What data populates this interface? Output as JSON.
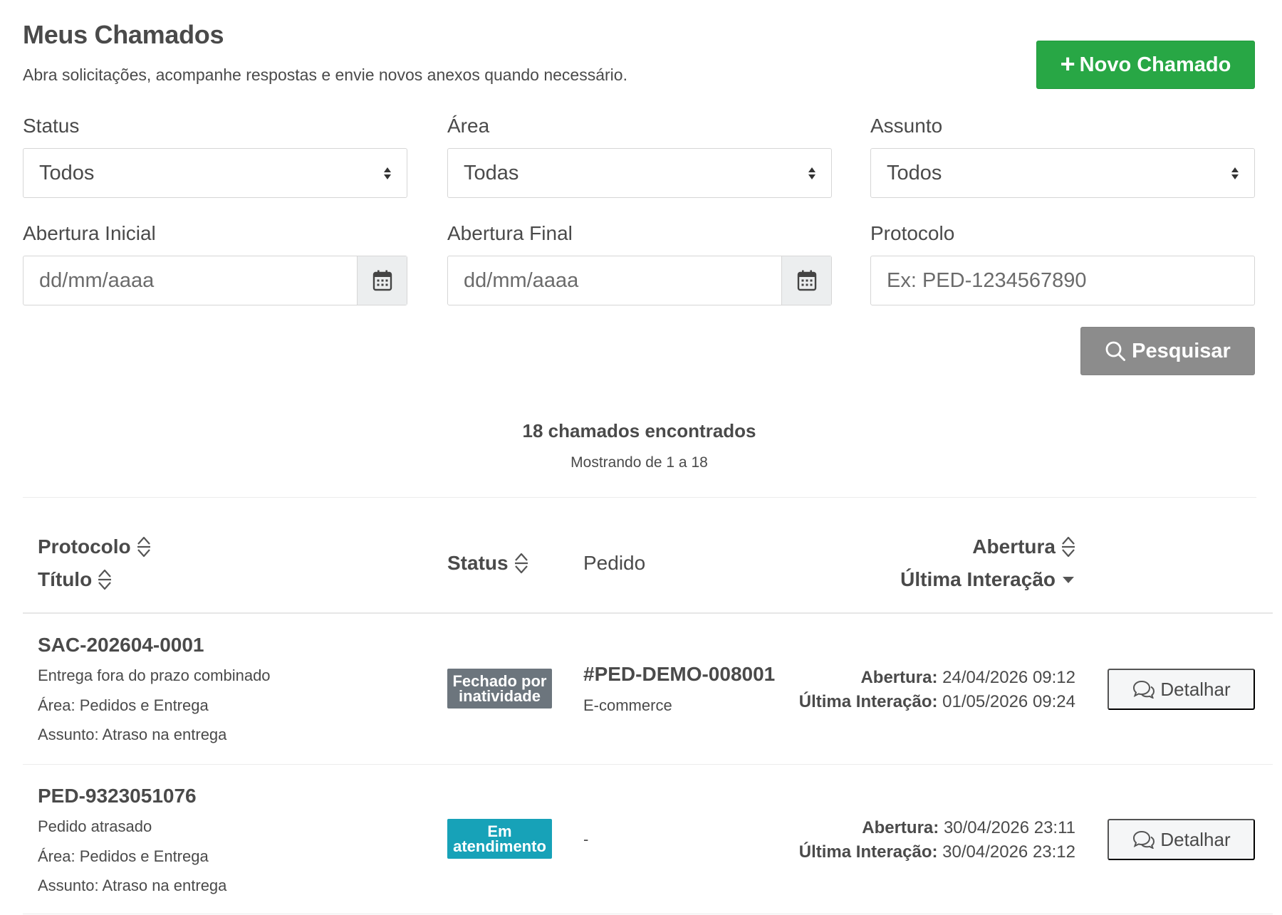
{
  "header": {
    "title": "Meus Chamados",
    "subtitle": "Abra solicitações, acompanhe respostas e envie novos anexos quando necessário.",
    "new_button_label": "Novo Chamado"
  },
  "filters": {
    "status": {
      "label": "Status",
      "value": "Todos"
    },
    "area": {
      "label": "Área",
      "value": "Todas"
    },
    "subject": {
      "label": "Assunto",
      "value": "Todos"
    },
    "opening_start": {
      "label": "Abertura Inicial",
      "placeholder": "dd/mm/aaaa"
    },
    "opening_end": {
      "label": "Abertura Final",
      "placeholder": "dd/mm/aaaa"
    },
    "protocol": {
      "label": "Protocolo",
      "placeholder": "Ex: PED-1234567890"
    },
    "search_button_label": "Pesquisar"
  },
  "results": {
    "count_text": "18 chamados encontrados",
    "range_text": "Mostrando de 1 a 18"
  },
  "table": {
    "headers": {
      "protocol": "Protocolo",
      "title": "Título",
      "status": "Status",
      "order": "Pedido",
      "opening": "Abertura",
      "last_interaction": "Última Interação"
    },
    "rows": [
      {
        "protocol": "SAC-202604-0001",
        "title": "Entrega fora do prazo combinado",
        "area": "Área: Pedidos e Entrega",
        "subject": "Assunto: Atraso na entrega",
        "status": "Fechado por inatividade",
        "status_color": "#6c757d",
        "order_id": "#PED-DEMO-008001",
        "order_channel": "E-commerce",
        "opening_label": "Abertura:",
        "opening_value": "24/04/2026 09:12",
        "last_label": "Última Interação:",
        "last_value": "01/05/2026 09:24",
        "detail_label": "Detalhar"
      },
      {
        "protocol": "PED-9323051076",
        "title": "Pedido atrasado",
        "area": "Área: Pedidos e Entrega",
        "subject": "Assunto: Atraso na entrega",
        "status": "Em atendimento",
        "status_color": "#17a2b8",
        "order_id": "",
        "order_empty": "-",
        "order_channel": "",
        "opening_label": "Abertura:",
        "opening_value": "30/04/2026 23:11",
        "last_label": "Última Interação:",
        "last_value": "30/04/2026 23:12",
        "detail_label": "Detalhar"
      }
    ]
  },
  "colors": {
    "primary_green": "#28a745",
    "search_gray": "#8c8c8c",
    "badge_closed": "#6c757d",
    "badge_in_progress": "#17a2b8"
  },
  "icons": [
    "plus-icon",
    "sort-icon",
    "sort-desc-icon",
    "calendar-icon",
    "search-icon",
    "chat-icon"
  ]
}
